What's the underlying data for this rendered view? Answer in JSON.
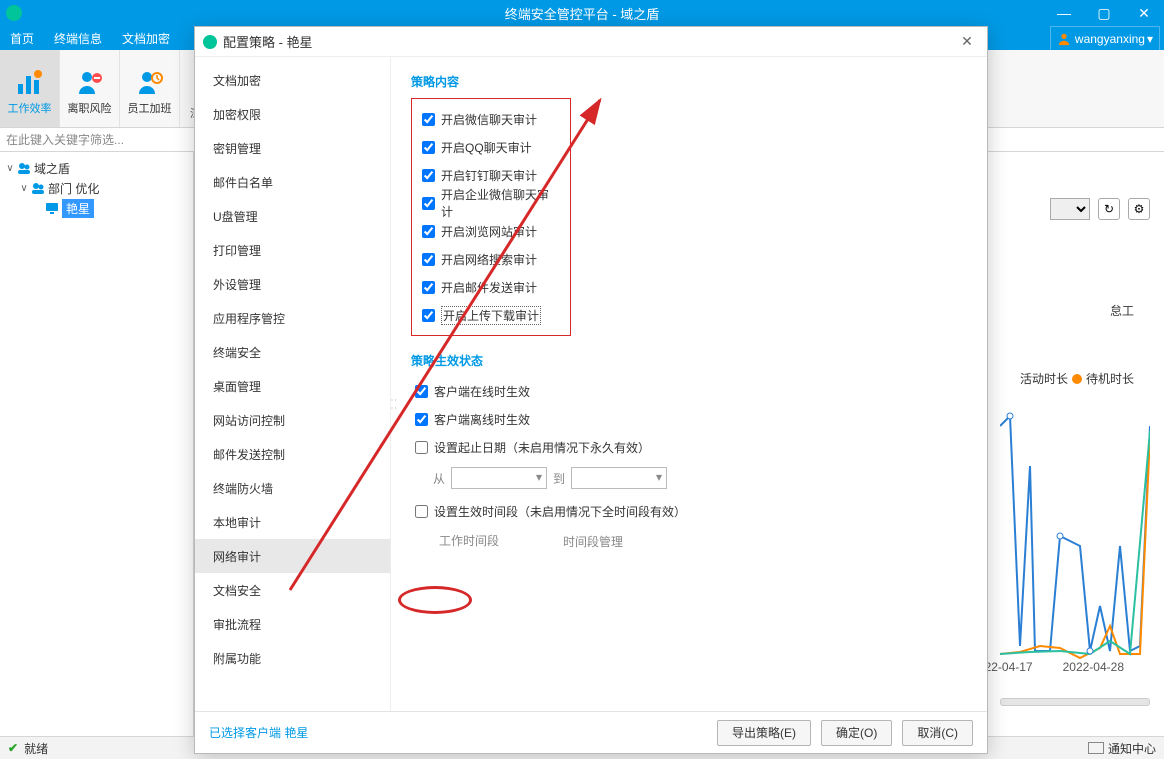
{
  "window": {
    "title": "终端安全管控平台 - 域之盾",
    "user": "wangyanxing"
  },
  "main_nav": [
    "首页",
    "终端信息",
    "文档加密"
  ],
  "toolbar": {
    "items": [
      {
        "label": "工作效率"
      },
      {
        "label": "离职风险"
      },
      {
        "label": "员工加班"
      }
    ],
    "extra": "深度行为分"
  },
  "filter_placeholder": "在此键入关键字筛选...",
  "tree": {
    "root": "域之盾",
    "dept": "部门 优化",
    "client": "艳星"
  },
  "right": {
    "select_placeholder": "",
    "idle_label": "怠工",
    "legend_active": "活动时长",
    "legend_idle": "待机时长",
    "x1": "22-04-17",
    "x2": "2022-04-28"
  },
  "statusbar": {
    "ready": "就绪",
    "notify": "通知中心"
  },
  "dialog": {
    "title": "配置策略 - 艳星",
    "sidebar": [
      "文档加密",
      "加密权限",
      "密钥管理",
      "邮件白名单",
      "U盘管理",
      "打印管理",
      "外设管理",
      "应用程序管控",
      "终端安全",
      "桌面管理",
      "网站访问控制",
      "邮件发送控制",
      "终端防火墙",
      "本地审计",
      "网络审计",
      "文档安全",
      "审批流程",
      "附属功能"
    ],
    "sidebar_selected": 14,
    "section1_title": "策略内容",
    "checks": [
      "开启微信聊天审计",
      "开启QQ聊天审计",
      "开启钉钉聊天审计",
      "开启企业微信聊天审计",
      "开启浏览网站审计",
      "开启网络搜索审计",
      "开启邮件发送审计",
      "开启上传下载审计"
    ],
    "section2_title": "策略生效状态",
    "online_label": "客户端在线时生效",
    "offline_label": "客户端离线时生效",
    "date_enable_label": "设置起止日期（未启用情况下永久有效）",
    "from_label": "从",
    "to_label": "到",
    "time_enable_label": "设置生效时间段（未启用情况下全时间段有效）",
    "worktime_label": "工作时间段",
    "timemanage_label": "时间段管理",
    "selected_client_prefix": "已选择客户端",
    "selected_client_name": "艳星",
    "btn_export": "导出策略(E)",
    "btn_ok": "确定(O)",
    "btn_cancel": "取消(C)"
  }
}
